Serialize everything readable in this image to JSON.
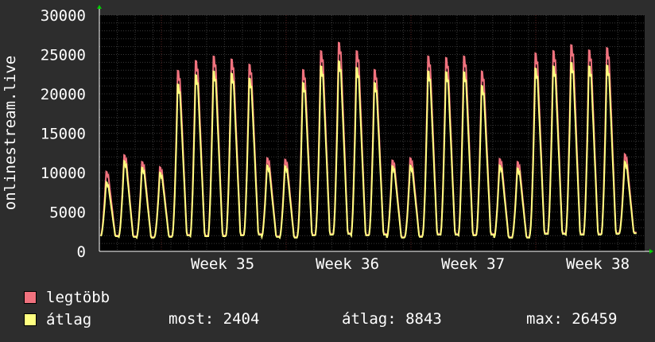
{
  "chart_data": {
    "type": "area",
    "ylabel": "onlinestream.live",
    "ylim": [
      0,
      30000
    ],
    "yticks": [
      0,
      5000,
      10000,
      15000,
      20000,
      25000,
      30000
    ],
    "x_ticks": [
      "Week 35",
      "Week 36",
      "Week 37",
      "Week 38"
    ],
    "grid": true,
    "colors": {
      "max": "#f0727e",
      "avg": "#ffff80",
      "background": "#000000",
      "grid": "#3a3a3a"
    },
    "series": [
      {
        "name": "legtöbb",
        "color": "#f0727e",
        "daily_peaks": [
          10500,
          12700,
          11800,
          11100,
          23900,
          25200,
          25800,
          25400,
          24700,
          12300,
          12100,
          24000,
          26500,
          27600,
          26500,
          24000,
          12000,
          12300,
          25800,
          25600,
          25800,
          23800,
          12200,
          11800,
          26200,
          26500,
          27300,
          26600,
          26900,
          12800
        ]
      },
      {
        "name": "átlag",
        "color": "#ffff80",
        "daily_peaks": [
          9500,
          12400,
          11500,
          10800,
          23000,
          24300,
          24800,
          24500,
          23800,
          11800,
          11700,
          23200,
          25500,
          26200,
          25300,
          23200,
          11700,
          11800,
          24800,
          24700,
          24700,
          22800,
          11800,
          11400,
          25200,
          25500,
          26000,
          25500,
          25600,
          12300
        ]
      }
    ],
    "stats": {
      "now": 2404,
      "avg": 8843,
      "max": 26459
    }
  },
  "legend": [
    {
      "label": "legtöbb",
      "color": "#f0727e"
    },
    {
      "label": "átlag",
      "color": "#ffff80"
    }
  ],
  "stats_text": {
    "now": "most: 2404",
    "avg": "átlag: 8843",
    "max": "max: 26459"
  }
}
